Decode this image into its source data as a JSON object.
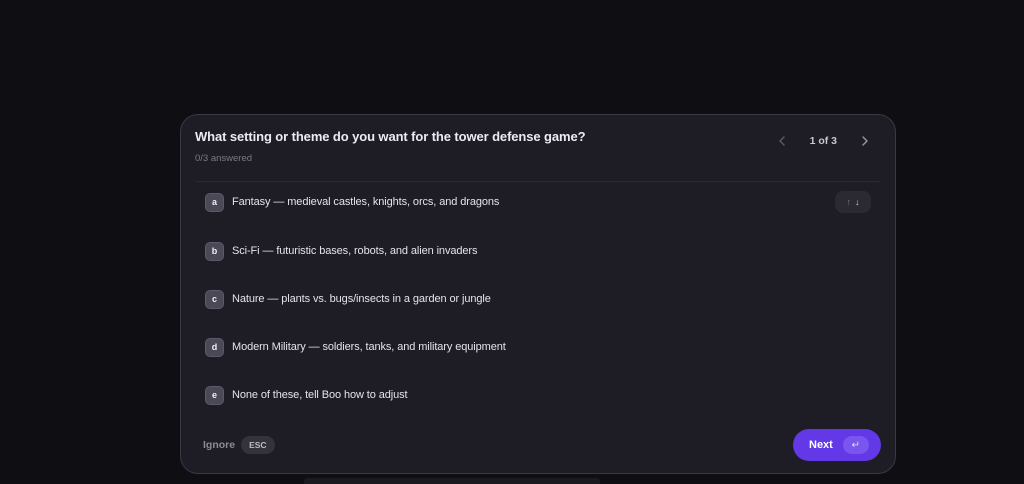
{
  "question": {
    "title": "What setting or theme do you want for the tower defense game?",
    "progress_text": "0/3 answered"
  },
  "pager": {
    "text": "1 of 3",
    "prev_icon": "chevron-left-icon",
    "next_icon": "chevron-right-icon"
  },
  "options": [
    {
      "key": "a",
      "label": "Fantasy — medieval castles, knights, orcs, and dragons"
    },
    {
      "key": "b",
      "label": "Sci-Fi — futuristic bases, robots, and alien invaders"
    },
    {
      "key": "c",
      "label": "Nature — plants vs. bugs/insects in a garden or jungle"
    },
    {
      "key": "d",
      "label": "Modern Military — soldiers, tanks, and military equipment"
    },
    {
      "key": "e",
      "label": "None of these, tell Boo how to adjust"
    }
  ],
  "arrows": {
    "up": "↑",
    "down": "↓"
  },
  "footer": {
    "ignore_label": "Ignore",
    "esc_label": "ESC",
    "next_label": "Next",
    "enter_glyph": "↵"
  },
  "colors": {
    "accent": "#6338e6",
    "card_background": "#1e1d25",
    "page_background": "#0f0e13"
  }
}
